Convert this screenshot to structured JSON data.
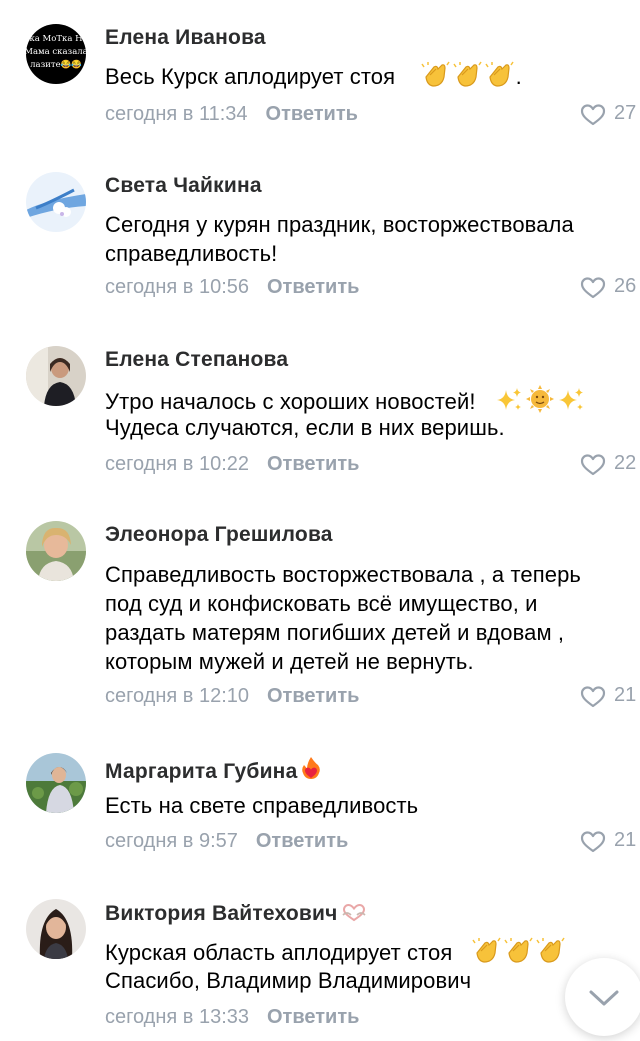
{
  "theme": {
    "author_color": "#2c2d2e",
    "meta_color": "#99a2ad",
    "text_color": "#000000"
  },
  "comments": [
    {
      "author": "Елена Иванова",
      "avatar": "avatar-text-image",
      "avatar_text": [
        "ка МоТка Н",
        "Мама сказала",
        "лазите😂😂"
      ],
      "text_lines": [
        "Весь Курск аплодирует стоя"
      ],
      "emoji_after": [
        "clapping-hands-icon",
        "clapping-hands-icon",
        "clapping-hands-icon"
      ],
      "trailing": ".",
      "time": "сегодня в 11:34",
      "reply": "Ответить",
      "likes": "27"
    },
    {
      "author": "Света Чайкина",
      "avatar": "avatar-flower-image",
      "text_lines": [
        "Сегодня у курян праздник, восторжествовала",
        "справедливость!"
      ],
      "time": "сегодня в 10:56",
      "reply": "Ответить",
      "likes": "26"
    },
    {
      "author": "Елена Степанова",
      "avatar": "avatar-photo",
      "text_lines": [
        "Утро началось с хороших новостей!",
        "Чудеса случаются, если в них веришь."
      ],
      "emoji_after": [
        "sparkles-icon",
        "sun-face-icon",
        "sparkles-icon"
      ],
      "time": "сегодня в 10:22",
      "reply": "Ответить",
      "likes": "22"
    },
    {
      "author": "Элеонора Грешилова",
      "avatar": "avatar-photo",
      "text_lines": [
        "Справедливость восторжествовала , а теперь",
        "под суд и конфисковать всё имущество, и",
        "раздать матерям погибших детей и вдовам ,",
        "которым мужей и детей не вернуть."
      ],
      "time": "сегодня в 12:10",
      "reply": "Ответить",
      "likes": "21"
    },
    {
      "author": "Маргарита Губина",
      "author_badge": "fire-heart-icon",
      "avatar": "avatar-photo",
      "text_lines": [
        "Есть на свете справедливость"
      ],
      "time": "сегодня в 9:57",
      "reply": "Ответить",
      "likes": "21"
    },
    {
      "author": "Виктория Вайтехович",
      "author_badge": "heart-hands-icon",
      "avatar": "avatar-photo",
      "text_lines": [
        "Курская область аплодирует стоя",
        "Спасибо, Владимир Владимирович"
      ],
      "emoji_after": [
        "clapping-hands-icon",
        "clapping-hands-icon",
        "clapping-hands-icon"
      ],
      "time": "сегодня в 13:33",
      "reply": "Ответить",
      "likes": ""
    }
  ],
  "scroll_down_icon": "chevron-down-icon"
}
